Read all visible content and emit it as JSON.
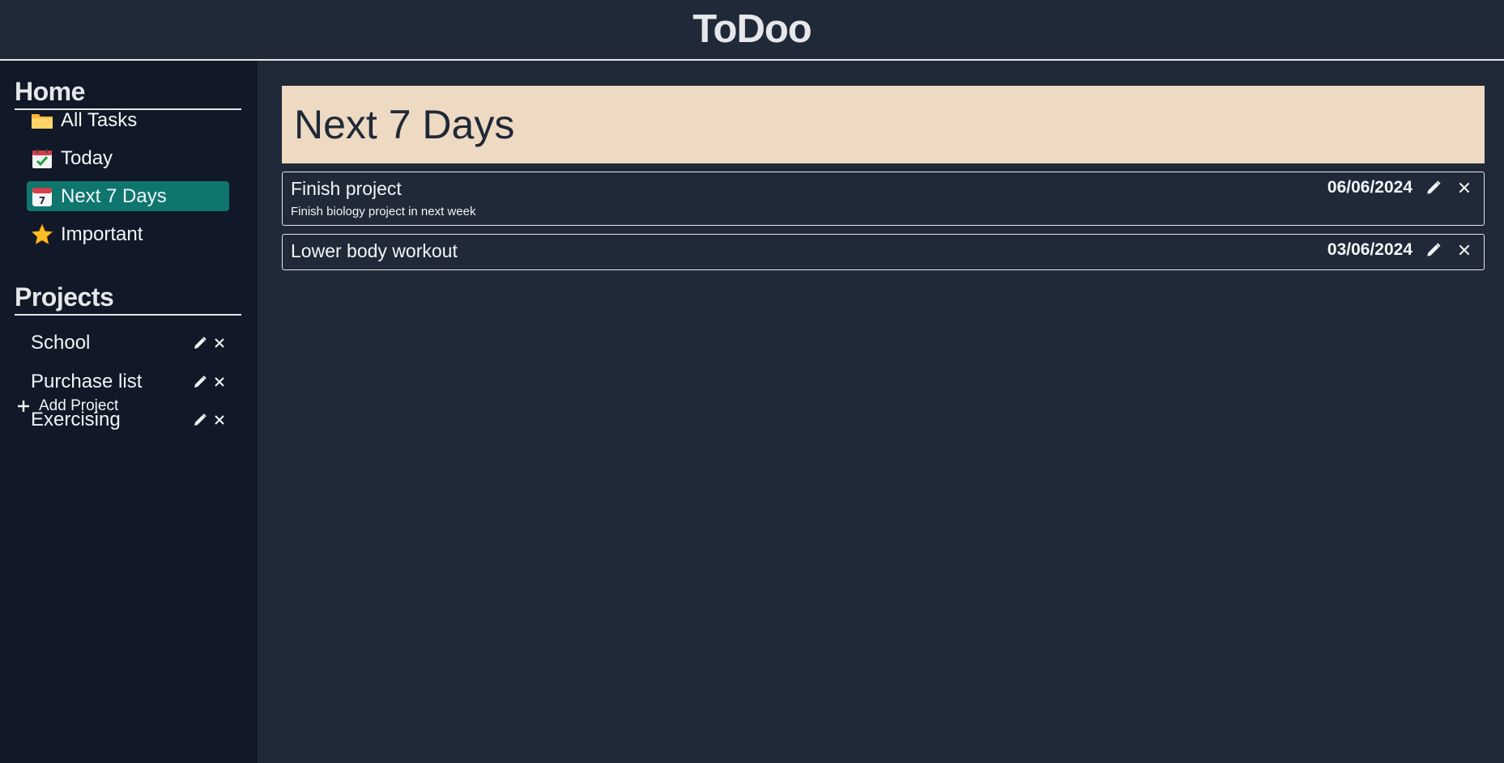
{
  "header": {
    "title": "ToDoo"
  },
  "sidebar": {
    "home_title": "Home",
    "nav_items": [
      {
        "label": "All Tasks",
        "icon": "folder-icon"
      },
      {
        "label": "Today",
        "icon": "calendar-check-icon"
      },
      {
        "label": "Next 7 Days",
        "icon": "calendar-7-icon",
        "active": true
      },
      {
        "label": "Important",
        "icon": "star-icon"
      }
    ],
    "projects_title": "Projects",
    "projects": [
      {
        "label": "School"
      },
      {
        "label": "Purchase list"
      },
      {
        "label": "Exercising"
      }
    ],
    "add_project_label": "Add Project"
  },
  "main": {
    "heading": "Next 7 Days",
    "tasks": [
      {
        "title": "Finish project",
        "description": "Finish biology project in next week",
        "date": "06/06/2024"
      },
      {
        "title": "Lower body workout",
        "description": "",
        "date": "03/06/2024"
      }
    ]
  },
  "colors": {
    "background": "#1f2937",
    "sidebar": "#111827",
    "accent_active": "#0f766e",
    "banner": "#eed9c2"
  }
}
